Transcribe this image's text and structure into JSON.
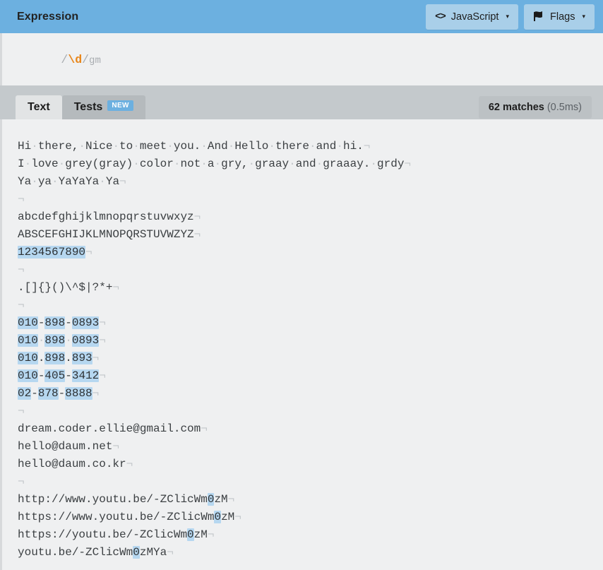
{
  "header": {
    "title": "Expression",
    "flavor_button": {
      "label": "JavaScript",
      "icon": "code-icon",
      "caret": "▾"
    },
    "flags_button": {
      "label": "Flags",
      "icon": "flag-icon",
      "caret": "▾"
    }
  },
  "expression": {
    "open_delim": "/",
    "pattern": "\\d",
    "close_delim": "/",
    "flags": "gm",
    "pattern_color": "#e8861a",
    "delim_color": "#a9adb1"
  },
  "tabs": [
    {
      "label": "Text",
      "active": true,
      "badge": null
    },
    {
      "label": "Tests",
      "active": false,
      "badge": "NEW"
    }
  ],
  "status": {
    "match_count": "62 matches",
    "duration": "(0.5ms)"
  },
  "glyphs": {
    "space_dot": "·",
    "eol_mark": "¬"
  },
  "accent_color": "#6cb0e0",
  "highlight_color": "#b6d7f0",
  "text_lines": [
    "Hi there, Nice to meet you. And Hello there and hi.",
    "I love grey(gray) color not a gry, graay and graaay. grdy",
    "Ya ya YaYaYa Ya",
    "",
    "abcdefghijklmnopqrstuvwxyz",
    "ABSCEFGHIJKLMNOPQRSTUVWZYZ",
    "1234567890",
    "",
    ".[]{}()\\^$|?*+",
    "",
    "010-898-0893",
    "010 898 0893",
    "010.898.893",
    "010-405-3412",
    "02-878-8888",
    "",
    "dream.coder.ellie@gmail.com",
    "hello@daum.net",
    "hello@daum.co.kr",
    "",
    "http://www.youtu.be/-ZClicWm0zM",
    "https://www.youtu.be/-ZClicWm0zM",
    "https://youtu.be/-ZClicWm0zM",
    "youtu.be/-ZClicWm0zMYa"
  ]
}
